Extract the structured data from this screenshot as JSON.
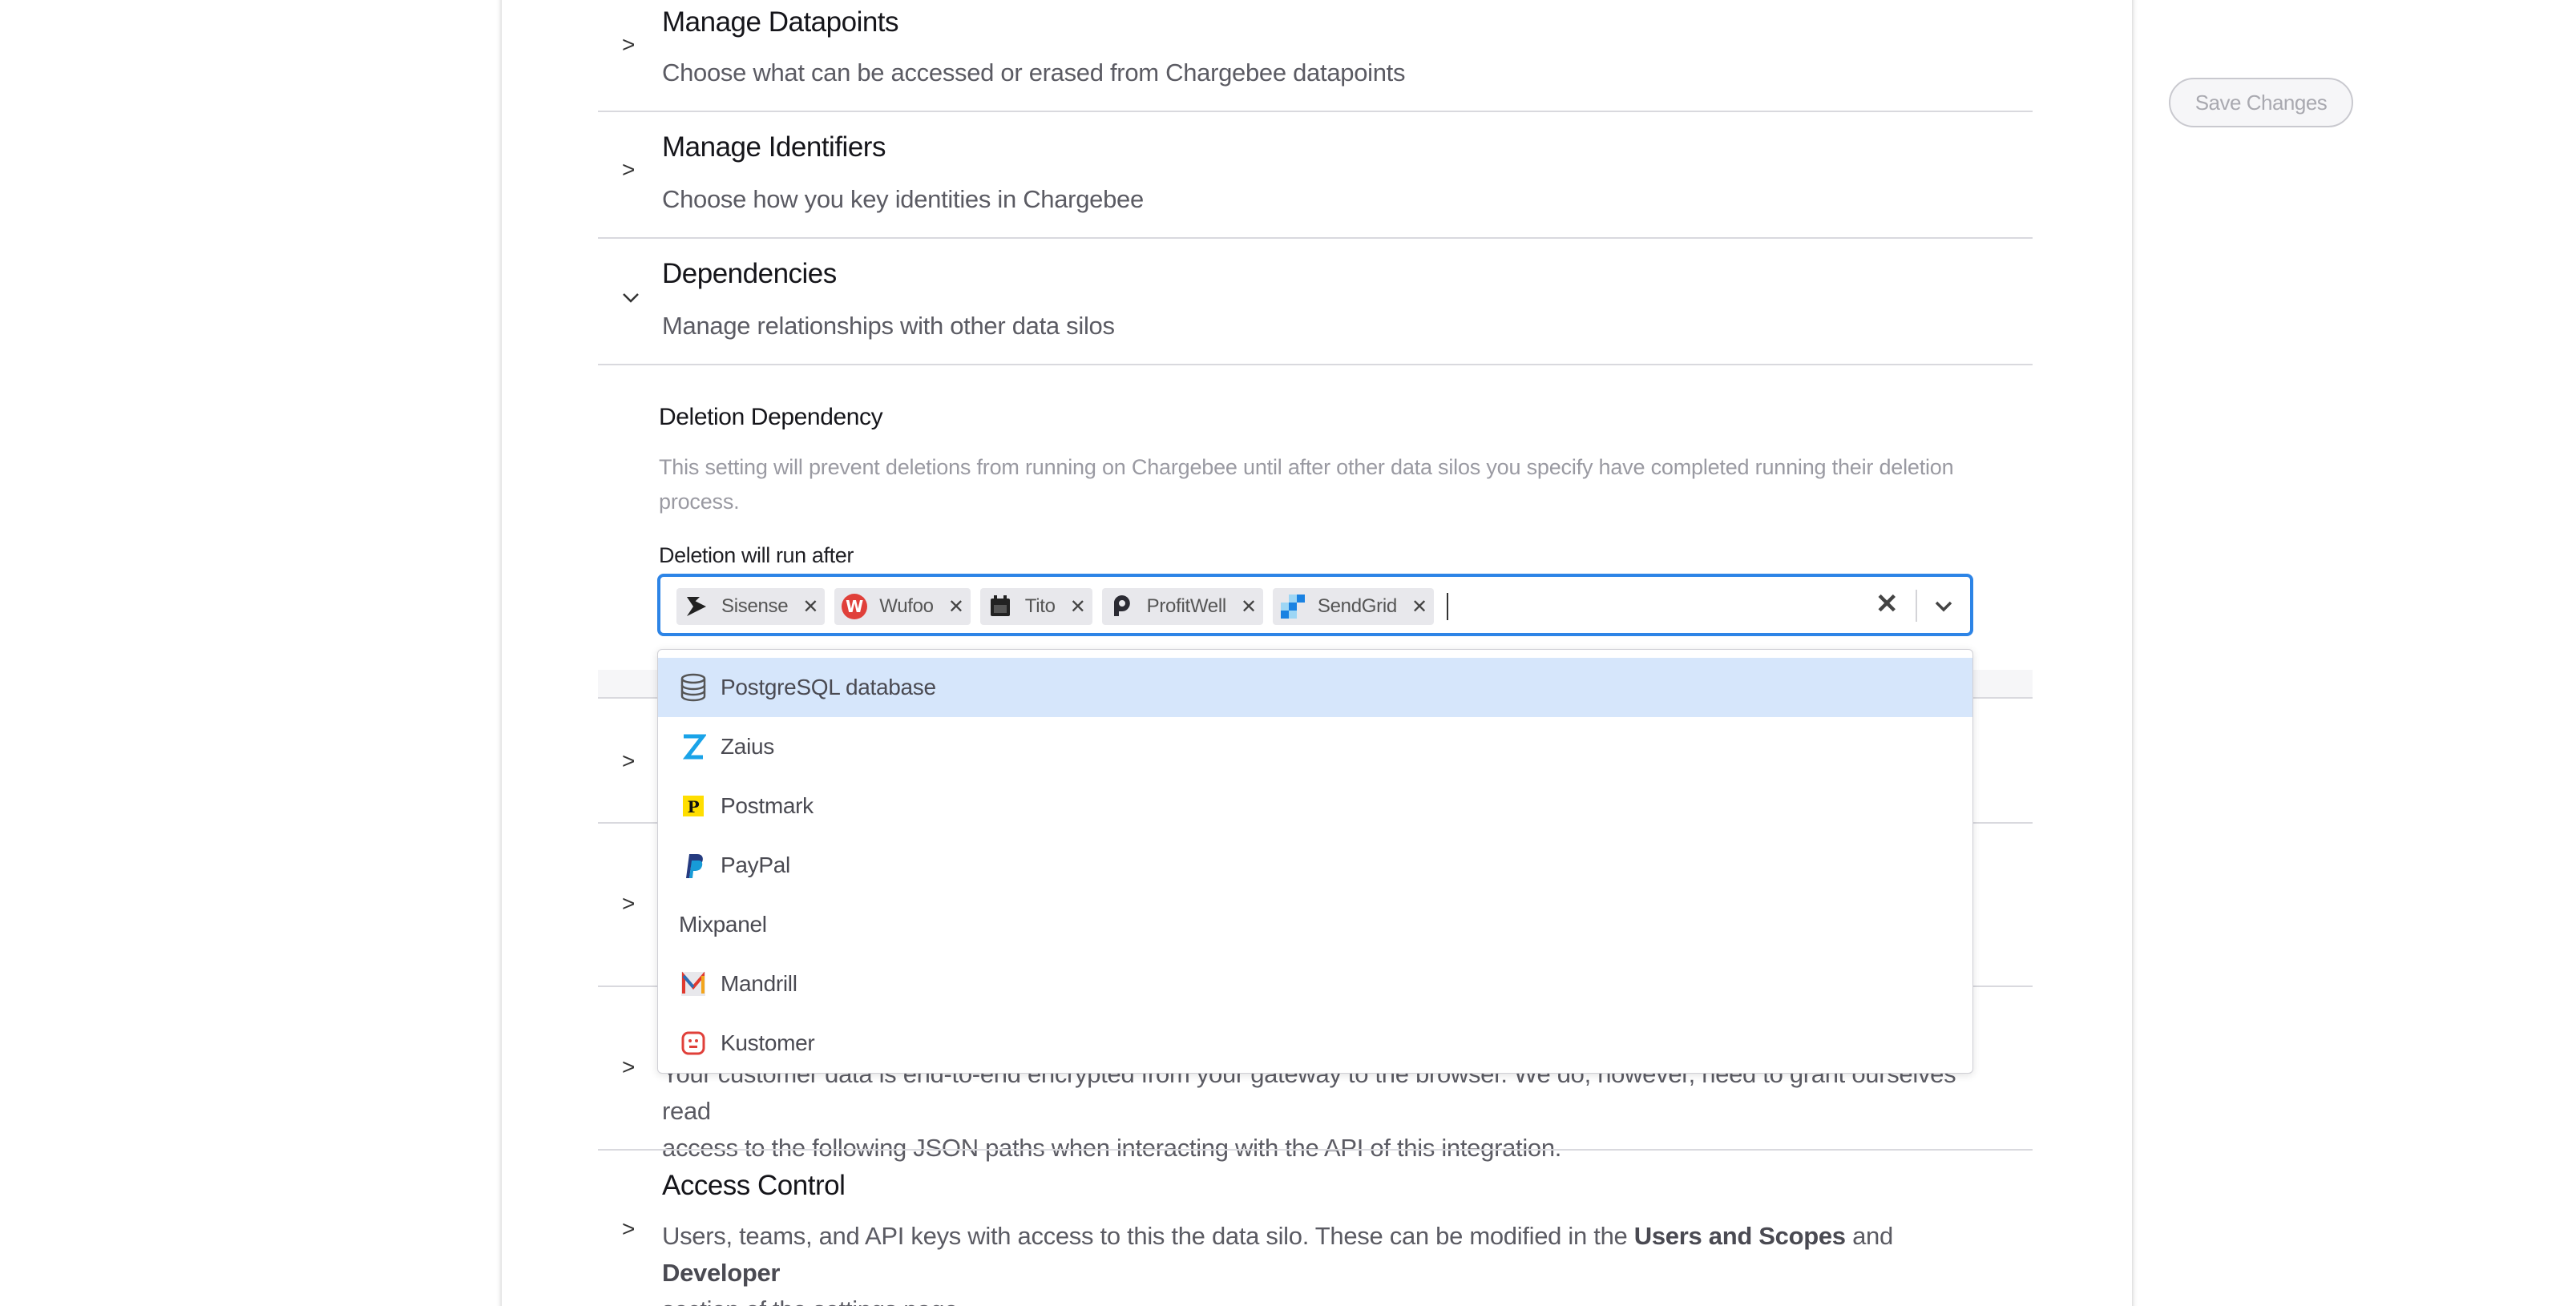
{
  "sections": {
    "manage_datapoints": {
      "title": "Manage Datapoints",
      "desc": "Choose what can be accessed or erased from Chargebee datapoints"
    },
    "manage_identifiers": {
      "title": "Manage Identifiers",
      "desc": "Choose how you key identities in Chargebee"
    },
    "dependencies": {
      "title": "Dependencies",
      "desc": "Manage relationships with other data silos"
    },
    "encryption": {
      "desc_line1": "Your customer data is end-to-end encrypted from your gateway to the browser. We do, however, need to grant ourselves read",
      "desc_line2": "access to the following JSON paths when interacting with the API of this integration."
    },
    "access_control": {
      "title": "Access Control",
      "desc_pre": "Users, teams, and API keys with access to this the data silo. These can be modified in the ",
      "link1": "Users and Scopes",
      "desc_mid": " and ",
      "link2": "Developer",
      "desc_line2": "section of the settings page."
    }
  },
  "save_button": "Save Changes",
  "deletion_dependency": {
    "title": "Deletion Dependency",
    "help_line1": "This setting will prevent deletions from running on Chargebee until after other data silos you specify have completed running their deletion",
    "help_line2": "process.",
    "label": "Deletion will run after",
    "chips": [
      "Sisense",
      "Wufoo",
      "Tito",
      "ProfitWell",
      "SendGrid"
    ]
  },
  "menu_options": [
    "PostgreSQL database",
    "Zaius",
    "Postmark",
    "PayPal",
    "Mixpanel",
    "Mandrill",
    "Kustomer"
  ],
  "colors": {
    "accent": "#2d84e6",
    "highlight": "#d6e6fb"
  }
}
